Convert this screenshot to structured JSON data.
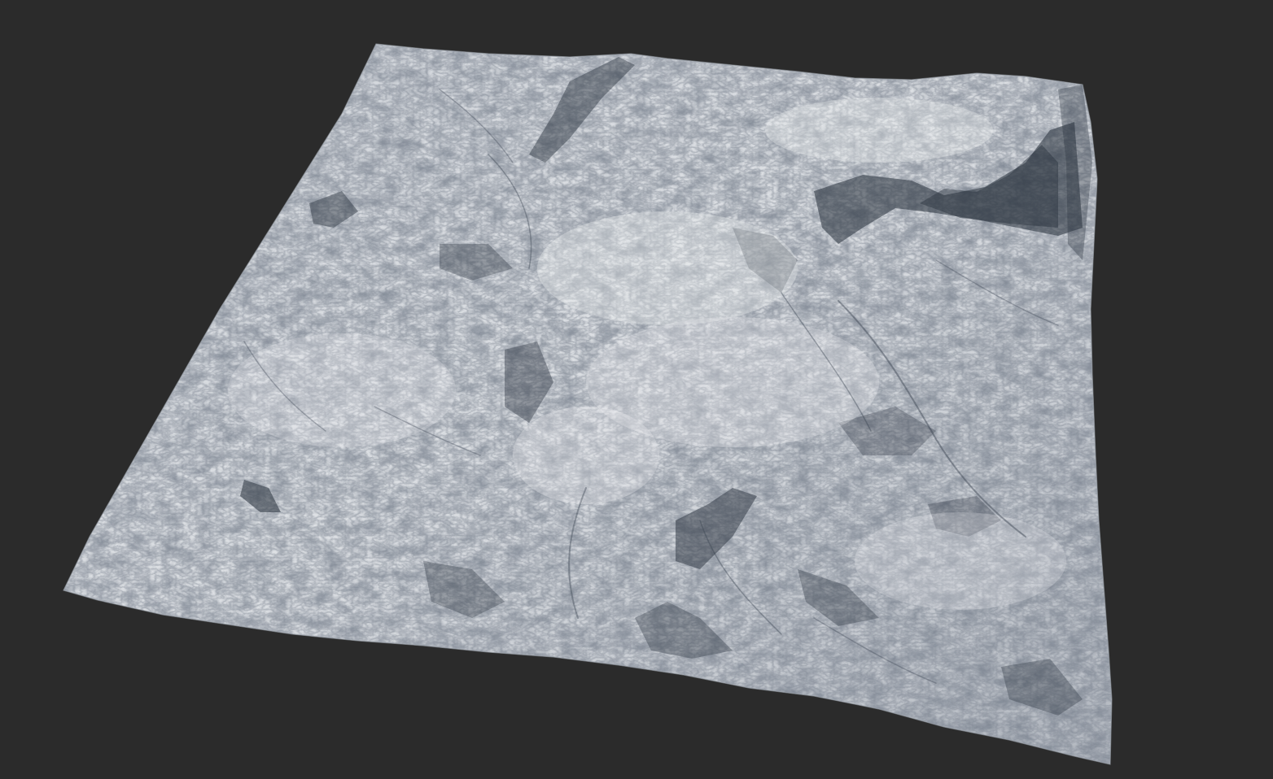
{
  "scene": {
    "subject": "terrain-heightmap-render",
    "colors": {
      "background": "#2b2b2b",
      "terrain_light": "#d9dde2",
      "terrain_mid": "#b7bcc3",
      "terrain_shadow": "#2c3440"
    }
  }
}
